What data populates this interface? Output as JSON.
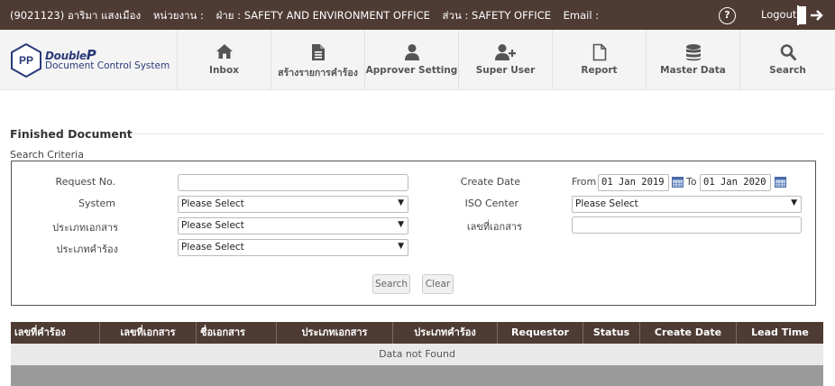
{
  "user_bar": {
    "user": "(9021123) อาริมา แสงเมือง",
    "unit_label": "หน่วยงาน :",
    "department": "ฝ่าย : SAFETY AND ENVIRONMENT OFFICE",
    "section": "ส่วน : SAFETY OFFICE",
    "email_label": "Email :",
    "help_glyph": "?",
    "logout_label": "Logout"
  },
  "logo": {
    "mark": "PP",
    "title_prefix": "Double",
    "title_suffix": "P",
    "subtitle": "Document Control System"
  },
  "nav": [
    {
      "key": "inbox",
      "label": "Inbox",
      "icon": "home-icon"
    },
    {
      "key": "create",
      "label": "สร้างรายการคำร้อง",
      "icon": "document-icon"
    },
    {
      "key": "approver",
      "label": "Approver Setting",
      "icon": "user-icon"
    },
    {
      "key": "superuser",
      "label": "Super User",
      "icon": "user-plus-icon"
    },
    {
      "key": "report",
      "label": "Report",
      "icon": "file-outline-icon"
    },
    {
      "key": "masterdata",
      "label": "Master Data",
      "icon": "database-icon"
    },
    {
      "key": "search",
      "label": "Search",
      "icon": "search-icon"
    }
  ],
  "page": {
    "title": "Finished Document",
    "criteria_label": "Search Criteria"
  },
  "form": {
    "request_no_label": "Request No.",
    "request_no_value": "",
    "system_label": "System",
    "system_value": "Please Select",
    "doc_type_label": "ประเภทเอกสาร",
    "doc_type_value": "Please Select",
    "request_type_label": "ประเภทคำร้อง",
    "request_type_value": "Please Select",
    "create_date_label": "Create Date",
    "from_label": "From",
    "from_value": "01 Jan 2019",
    "to_label": "To",
    "to_value": "01 Jan 2020",
    "iso_center_label": "ISO Center",
    "iso_center_value": "Please Select",
    "doc_no_label": "เลขที่เอกสาร",
    "doc_no_value": "",
    "search_button": "Search",
    "clear_button": "Clear",
    "arrow_glyph": "▼"
  },
  "table": {
    "columns": [
      "เลขที่คำร้อง",
      "เลขที่เอกสาร",
      "ชื่อเอกสาร",
      "ประเภทเอกสาร",
      "ประเภทคำร้อง",
      "Requestor",
      "Status",
      "Create Date",
      "Lead Time"
    ],
    "empty_message": "Data not Found"
  },
  "colors": {
    "header_brown": "#4e3b34",
    "nav_background": "#f4f4f4",
    "logo_blue": "#2a3a7a"
  }
}
